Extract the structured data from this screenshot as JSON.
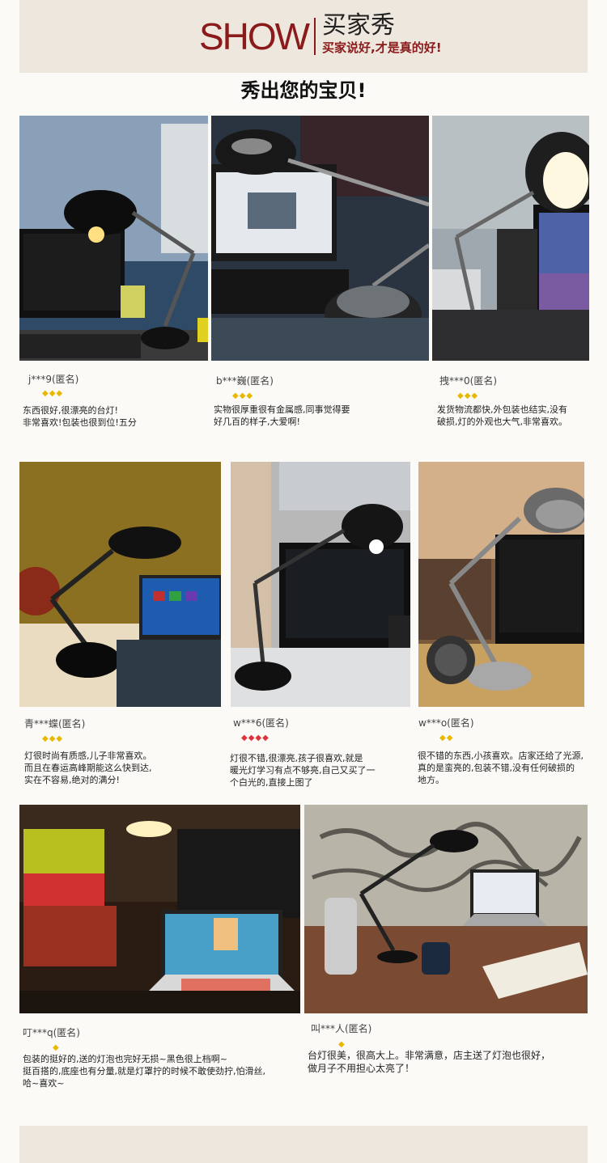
{
  "header": {
    "title_en": "SHOW",
    "title_cn": "买家秀",
    "tagline": "买家说好,才是真的好!"
  },
  "subtitle": "秀出您的宝贝!",
  "reviews": [
    {
      "user": "j***9(匿名)",
      "rating": 3,
      "comment": "东西很好,很漂亮的台灯!\n非常喜欢!包装也很到位!五分"
    },
    {
      "user": "b***巍(匿名)",
      "rating": 3,
      "comment": "实物很厚重很有金属感,同事觉得要\n好几百的样子,大爱啊!"
    },
    {
      "user": "拽***0(匿名)",
      "rating": 3,
      "comment": "发货物流都快,外包装也结实,没有\n破损,灯的外观也大气,非常喜欢。"
    },
    {
      "user": "青***蝶(匿名)",
      "rating": 3,
      "comment": "灯很时尚有质感,儿子非常喜欢。\n而且在春运高峰期能这么快到达,\n实在不容易,绝对的满分!"
    },
    {
      "user": "w***6(匿名)",
      "rating": 4,
      "comment": "灯很不错,很漂亮,孩子很喜欢,就是\n暖光灯学习有点不够亮,自己又买了一\n个白光的,直接上图了"
    },
    {
      "user": "w***o(匿名)",
      "rating": 2,
      "comment": "很不错的东西,小孩喜欢。店家还给了光源,\n真的是蛮亮的,包装不错,没有任何破损的\n地方。"
    },
    {
      "user": "叮***q(匿名)",
      "rating": 1,
      "comment": "包装的挺好的,送的灯泡也完好无损~黑色很上档啊~\n挺百搭的,底座也有分量,就是灯罩拧的时候不敢使劲拧,怕滑丝,\n哈~喜欢~"
    },
    {
      "user": "叫***人(匿名)",
      "rating": 1,
      "comment": "台灯很美，很高大上。非常满意，店主送了灯泡也很好，\n做月子不用担心太亮了！"
    }
  ],
  "colors": {
    "brand": "#8b1a1a",
    "band": "#ede7dd",
    "star": "#e8b800",
    "star_red": "#e0303a"
  }
}
